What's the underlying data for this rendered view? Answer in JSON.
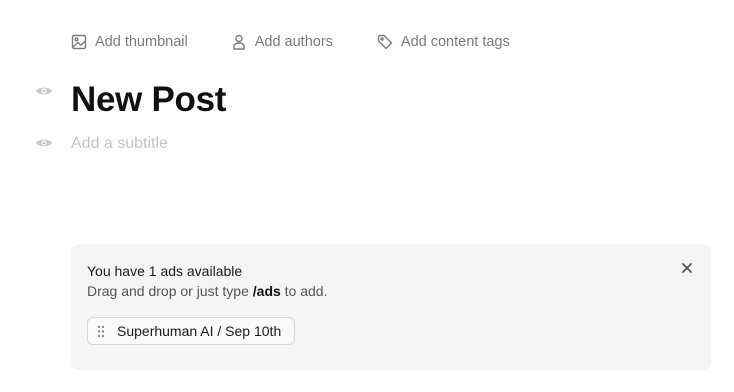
{
  "meta_actions": {
    "thumbnail": {
      "label": "Add thumbnail",
      "icon": "image-icon"
    },
    "authors": {
      "label": "Add authors",
      "icon": "person-icon"
    },
    "tags": {
      "label": "Add content tags",
      "icon": "tag-icon"
    }
  },
  "post": {
    "title": "New Post",
    "subtitle_placeholder": "Add a subtitle"
  },
  "ads": {
    "heading": "You have 1 ads available",
    "hint_prefix": "Drag and drop or just type",
    "hint_command": "/ads",
    "hint_suffix": "to add.",
    "items": [
      {
        "label": "Superhuman AI / Sep 10th"
      }
    ]
  },
  "colors": {
    "muted_text": "#7a7a7a",
    "title_text": "#111111",
    "placeholder_text": "#c4c4c4",
    "panel_bg": "#f5f5f5",
    "chip_border": "#d6d6d6"
  }
}
